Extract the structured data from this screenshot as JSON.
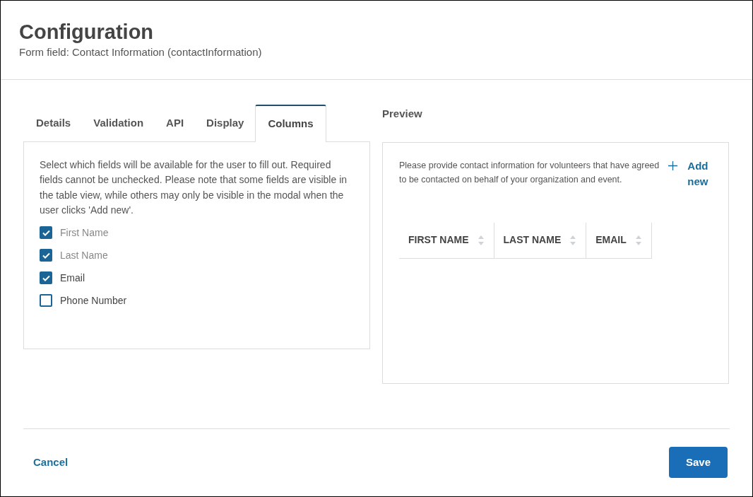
{
  "header": {
    "title": "Configuration",
    "subtitle": "Form field: Contact Information (contactInformation)"
  },
  "tabs": [
    {
      "label": "Details",
      "selected": false
    },
    {
      "label": "Validation",
      "selected": false
    },
    {
      "label": "API",
      "selected": false
    },
    {
      "label": "Display",
      "selected": false
    },
    {
      "label": "Columns",
      "selected": true
    }
  ],
  "columns_panel": {
    "description": "Select which fields will be available for the user to fill out. Required fields cannot be unchecked. Please note that some fields are visible in the table view, while others may only be visible in the modal when the user clicks 'Add new'.",
    "fields": [
      {
        "label": "First Name",
        "checked": true,
        "disabled": true
      },
      {
        "label": "Last Name",
        "checked": true,
        "disabled": true
      },
      {
        "label": "Email",
        "checked": true,
        "disabled": false
      },
      {
        "label": "Phone Number",
        "checked": false,
        "disabled": false
      }
    ]
  },
  "preview": {
    "title": "Preview",
    "description": "Please provide contact information for volunteers that have agreed to be contacted on behalf of your organization and event.",
    "add_button": "Add new",
    "table": {
      "columns": [
        "FIRST NAME",
        "LAST NAME",
        "EMAIL"
      ]
    }
  },
  "footer": {
    "cancel": "Cancel",
    "save": "Save"
  }
}
